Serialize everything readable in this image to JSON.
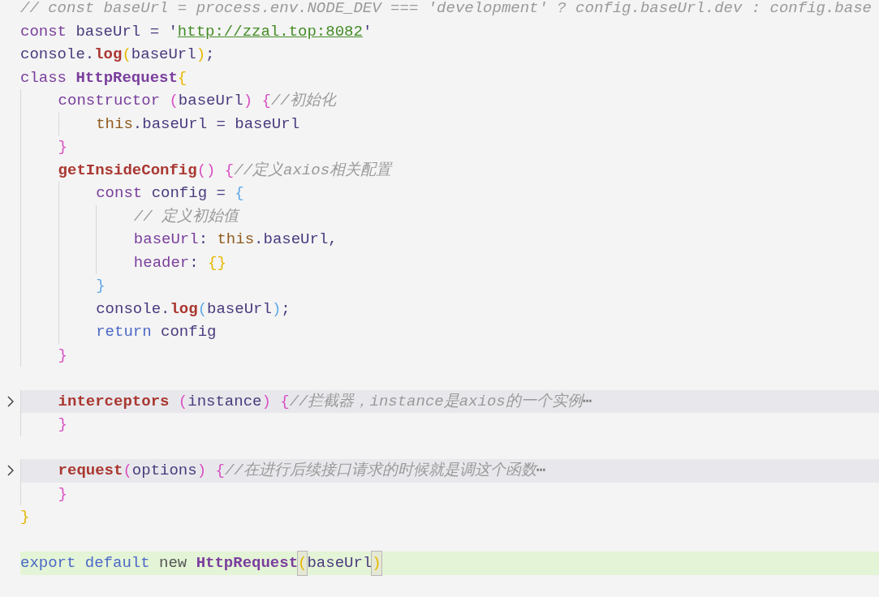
{
  "editor": {
    "lines": [
      {
        "tokens": [
          {
            "text": "// const baseUrl = process.env.NODE_DEV === 'development' ? config.baseUrl.dev : config.base",
            "kind": "cmt"
          }
        ]
      },
      {
        "tokens": [
          {
            "text": "const",
            "kind": "kw"
          },
          {
            "text": " baseUrl = '",
            "kind": "plain"
          },
          {
            "text": "http://zzal.top:8082",
            "kind": "str"
          },
          {
            "text": "'",
            "kind": "plain"
          }
        ]
      },
      {
        "tokens": [
          {
            "text": "console.",
            "kind": "plain"
          },
          {
            "text": "log",
            "kind": "fn"
          },
          {
            "text": "(",
            "kind": "b1"
          },
          {
            "text": "baseUrl",
            "kind": "plain"
          },
          {
            "text": ")",
            "kind": "b1"
          },
          {
            "text": ";",
            "kind": "plain"
          }
        ]
      },
      {
        "tokens": [
          {
            "text": "class ",
            "kind": "kw"
          },
          {
            "text": "HttpRequest",
            "kind": "cls"
          },
          {
            "text": "{",
            "kind": "b1"
          }
        ]
      },
      {
        "tokens": [
          {
            "text": "    constructor ",
            "kind": "kw"
          },
          {
            "text": "(",
            "kind": "b2"
          },
          {
            "text": "baseUrl",
            "kind": "plain"
          },
          {
            "text": ") {",
            "kind": "b2"
          },
          {
            "text": "//初始化",
            "kind": "cmt"
          }
        ]
      },
      {
        "tokens": [
          {
            "text": "        this",
            "kind": "this"
          },
          {
            "text": ".baseUrl = baseUrl",
            "kind": "plain"
          }
        ]
      },
      {
        "tokens": [
          {
            "text": "    }",
            "kind": "b2"
          }
        ]
      },
      {
        "tokens": [
          {
            "text": "    getInsideConfig",
            "kind": "fn"
          },
          {
            "text": "() {",
            "kind": "b2"
          },
          {
            "text": "//定义axios相关配置",
            "kind": "cmt"
          }
        ]
      },
      {
        "tokens": [
          {
            "text": "        const",
            "kind": "kw"
          },
          {
            "text": " config = ",
            "kind": "plain"
          },
          {
            "text": "{",
            "kind": "b3"
          }
        ]
      },
      {
        "tokens": [
          {
            "text": "            // 定义初始值",
            "kind": "cmt"
          }
        ]
      },
      {
        "tokens": [
          {
            "text": "            baseUrl",
            "kind": "kw"
          },
          {
            "text": ": ",
            "kind": "plain"
          },
          {
            "text": "this",
            "kind": "this"
          },
          {
            "text": ".baseUrl,",
            "kind": "plain"
          }
        ]
      },
      {
        "tokens": [
          {
            "text": "            header",
            "kind": "kw"
          },
          {
            "text": ": ",
            "kind": "plain"
          },
          {
            "text": "{}",
            "kind": "b1"
          }
        ]
      },
      {
        "tokens": [
          {
            "text": "        }",
            "kind": "b3"
          }
        ]
      },
      {
        "tokens": [
          {
            "text": "        console.",
            "kind": "plain"
          },
          {
            "text": "log",
            "kind": "fn"
          },
          {
            "text": "(",
            "kind": "b3"
          },
          {
            "text": "baseUrl",
            "kind": "plain"
          },
          {
            "text": ")",
            "kind": "b3"
          },
          {
            "text": ";",
            "kind": "plain"
          }
        ]
      },
      {
        "tokens": [
          {
            "text": "        return",
            "kind": "kw2"
          },
          {
            "text": " config",
            "kind": "plain"
          }
        ]
      },
      {
        "tokens": [
          {
            "text": "    }",
            "kind": "b2"
          }
        ]
      },
      {
        "folded": false
      },
      {
        "folded": true,
        "tokens": [
          {
            "text": "    interceptors ",
            "kind": "fn"
          },
          {
            "text": "(",
            "kind": "b2"
          },
          {
            "text": "instance",
            "kind": "plain"
          },
          {
            "text": ") {",
            "kind": "b2"
          },
          {
            "text": "//拦截器，instance是axios的一个实例",
            "kind": "cmt"
          },
          {
            "text": "⋯",
            "kind": "dots"
          }
        ]
      },
      {
        "tokens": [
          {
            "text": "    }",
            "kind": "b2"
          }
        ]
      },
      {
        "folded": false
      },
      {
        "folded": true,
        "tokens": [
          {
            "text": "    request",
            "kind": "fn"
          },
          {
            "text": "(",
            "kind": "b2"
          },
          {
            "text": "options",
            "kind": "plain"
          },
          {
            "text": ") {",
            "kind": "b2"
          },
          {
            "text": "//在进行后续接口请求的时候就是调这个函数",
            "kind": "cmt"
          },
          {
            "text": "⋯",
            "kind": "dots"
          }
        ]
      },
      {
        "tokens": [
          {
            "text": "    }",
            "kind": "b2"
          }
        ]
      },
      {
        "tokens": [
          {
            "text": "}",
            "kind": "b1"
          }
        ]
      },
      {
        "folded": false
      },
      {
        "current": true,
        "tokens": [
          {
            "text": "export default ",
            "kind": "kw2"
          },
          {
            "text": "new ",
            "kind": "new"
          },
          {
            "text": "HttpRequest",
            "kind": "cls"
          },
          {
            "text": "(",
            "kind": "match"
          },
          {
            "text": "baseUrl",
            "kind": "plain"
          },
          {
            "text": ")",
            "kind": "match"
          }
        ]
      }
    ]
  }
}
